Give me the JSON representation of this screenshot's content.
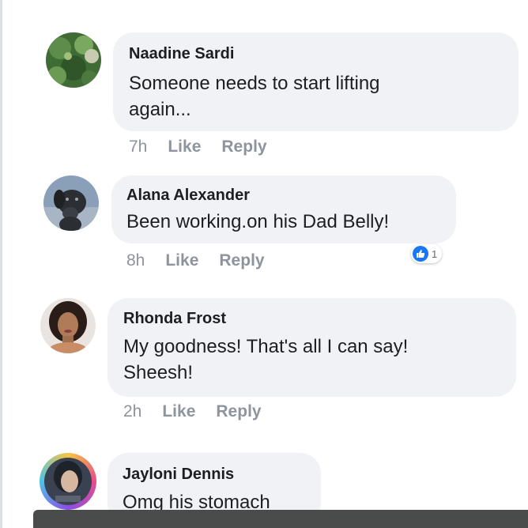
{
  "comments": [
    {
      "author": "Naadine Sardi",
      "text_lines": [
        "Someone needs to start lifting",
        "again..."
      ],
      "time": "7h",
      "like_label": "Like",
      "reply_label": "Reply",
      "avatar": "nature-photo-avatar"
    },
    {
      "author": "Alana Alexander",
      "text_lines": [
        "Been working.on his Dad Belly!"
      ],
      "time": "8h",
      "like_label": "Like",
      "reply_label": "Reply",
      "avatar": "dog-photo-avatar",
      "reaction": {
        "type": "like",
        "count": "1"
      }
    },
    {
      "author": "Rhonda Frost",
      "text_lines": [
        "My goodness! That's all I can say!",
        "Sheesh!"
      ],
      "time": "2h",
      "like_label": "Like",
      "reply_label": "Reply",
      "avatar": "woman-photo-avatar"
    },
    {
      "author": "Jayloni Dennis",
      "text_lines": [
        "Omg his stomach"
      ],
      "avatar": "woman-photo-avatar-ring"
    }
  ],
  "colors": {
    "bubble": "#f0f2f5",
    "meta_text": "#8d949e",
    "like_blue": "#1877f2",
    "bottom_bar": "#4a4c4b"
  }
}
